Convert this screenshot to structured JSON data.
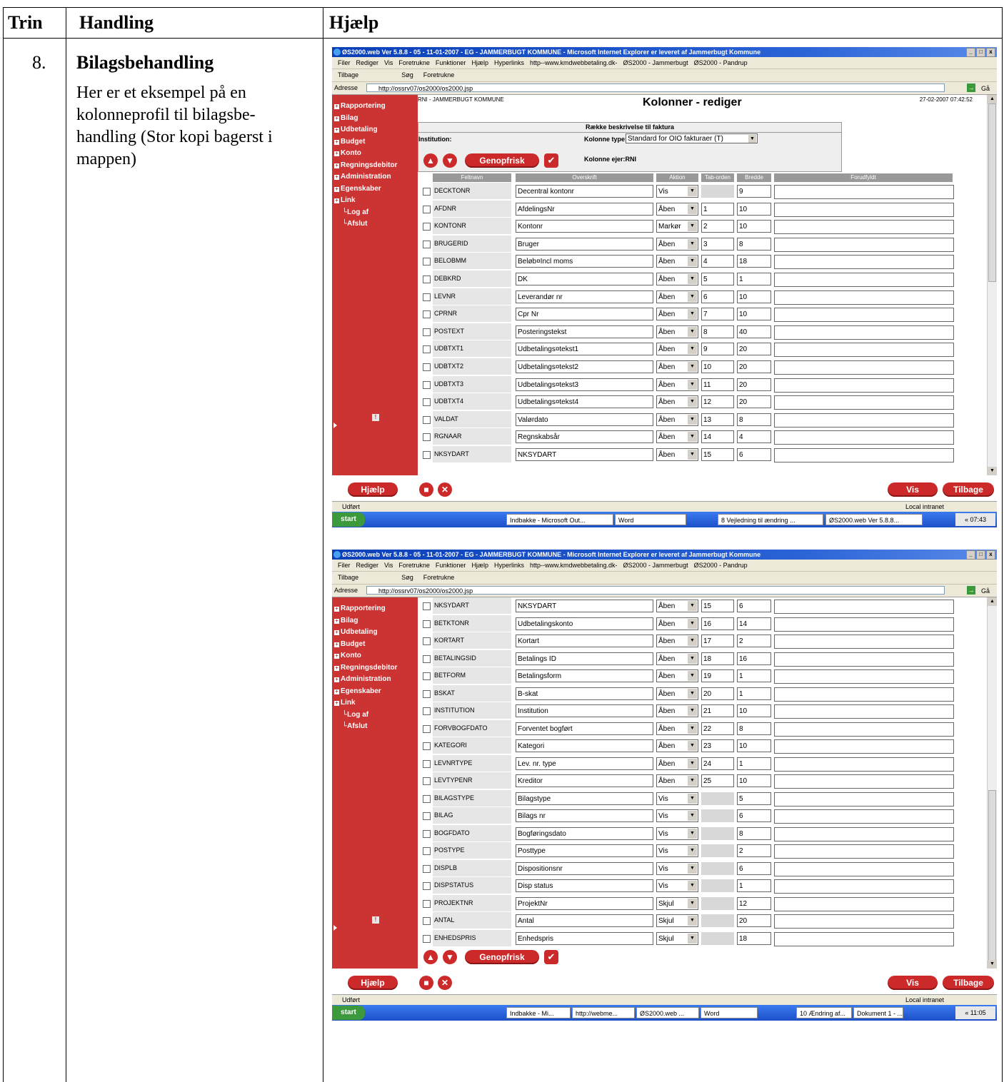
{
  "doc": {
    "headers": {
      "trin": "Trin",
      "handling": "Handling",
      "hjaelp": "Hjælp"
    },
    "step_number": "8.",
    "handling_title": "Bilagsbehandling",
    "handling_lines": [
      "Her er et eksempel på en",
      "kolonneprofil til bilagsbe-",
      "handling (Stor kopi bagerst i",
      "mappen)"
    ]
  },
  "browser": {
    "title": "ØS2000.web Ver 5.8.8 - 05 - 11-01-2007 - EG - JAMMERBUGT KOMMUNE - Microsoft Internet Explorer er leveret af Jammerbugt Kommune",
    "menu": [
      "Filer",
      "Rediger",
      "Vis",
      "Foretrukne",
      "Funktioner",
      "Hjælp",
      "Hyperlinks",
      "http--www.kmdwebbetaling.dk-",
      "ØS2000 - Jammerbugt",
      "ØS2000 - Pandrup"
    ],
    "toolbar": [
      "Tilbage",
      "Søg",
      "Foretrukne"
    ],
    "address_label": "Adresse",
    "address": "http://ossrv07/os2000/os2000.jsp",
    "go": "Gå",
    "status": "Udført",
    "zone": "Local intranet"
  },
  "sidebar": [
    "Rapportering",
    "Bilag",
    "Udbetaling",
    "Budget",
    "Konto",
    "Regningsdebitor",
    "Administration",
    "Egenskaber",
    "Link",
    "Log af",
    "Afslut"
  ],
  "page": {
    "header_left": "RNI  -  JAMMERBUGT KOMMUNE",
    "title": "Kolonner - rediger",
    "datetime": "27-02-2007 07:42:52",
    "desc_label": "Række beskrivelse til faktura",
    "institution_label": "Institution:",
    "kolonne_type_label": "Kolonne type:",
    "kolonne_type_value": "Standard for OIO fakturaer (T)",
    "kolonne_ejer": "Kolonne ejer:RNI",
    "refresh": "Genopfrisk",
    "columns": [
      "Feltnavn",
      "Overskrift",
      "Aktion",
      "Tab-orden",
      "Bredde",
      "Forudfyldt"
    ],
    "help": "Hjælp",
    "vis": "Vis",
    "tilbage": "Tilbage"
  },
  "rows1": [
    {
      "f": "DECKTONR",
      "o": "Decentral kontonr",
      "a": "Vis",
      "t": "",
      "b": "9"
    },
    {
      "f": "AFDNR",
      "o": "AfdelingsNr",
      "a": "Åben",
      "t": "1",
      "b": "10"
    },
    {
      "f": "KONTONR",
      "o": "Kontonr",
      "a": "Markør",
      "t": "2",
      "b": "10"
    },
    {
      "f": "BRUGERID",
      "o": "Bruger",
      "a": "Åben",
      "t": "3",
      "b": "8"
    },
    {
      "f": "BELOBMM",
      "o": "Beløb¤Incl moms",
      "a": "Åben",
      "t": "4",
      "b": "18"
    },
    {
      "f": "DEBKRD",
      "o": "DK",
      "a": "Åben",
      "t": "5",
      "b": "1"
    },
    {
      "f": "LEVNR",
      "o": "Leverandør nr",
      "a": "Åben",
      "t": "6",
      "b": "10"
    },
    {
      "f": "CPRNR",
      "o": "Cpr Nr",
      "a": "Åben",
      "t": "7",
      "b": "10"
    },
    {
      "f": "POSTEXT",
      "o": "Posteringstekst",
      "a": "Åben",
      "t": "8",
      "b": "40"
    },
    {
      "f": "UDBTXT1",
      "o": "Udbetalings¤tekst1",
      "a": "Åben",
      "t": "9",
      "b": "20"
    },
    {
      "f": "UDBTXT2",
      "o": "Udbetalings¤tekst2",
      "a": "Åben",
      "t": "10",
      "b": "20"
    },
    {
      "f": "UDBTXT3",
      "o": "Udbetalings¤tekst3",
      "a": "Åben",
      "t": "11",
      "b": "20"
    },
    {
      "f": "UDBTXT4",
      "o": "Udbetalings¤tekst4",
      "a": "Åben",
      "t": "12",
      "b": "20"
    },
    {
      "f": "VALDAT",
      "o": "Valørdato",
      "a": "Åben",
      "t": "13",
      "b": "8"
    },
    {
      "f": "RGNAAR",
      "o": "Regnskabsår",
      "a": "Åben",
      "t": "14",
      "b": "4"
    },
    {
      "f": "NKSYDART",
      "o": "NKSYDART",
      "a": "Åben",
      "t": "15",
      "b": "6"
    }
  ],
  "rows2": [
    {
      "f": "NKSYDART",
      "o": "NKSYDART",
      "a": "Åben",
      "t": "15",
      "b": "6"
    },
    {
      "f": "BETKTONR",
      "o": "Udbetalingskonto",
      "a": "Åben",
      "t": "16",
      "b": "14"
    },
    {
      "f": "KORTART",
      "o": "Kortart",
      "a": "Åben",
      "t": "17",
      "b": "2"
    },
    {
      "f": "BETALINGSID",
      "o": "Betalings ID",
      "a": "Åben",
      "t": "18",
      "b": "16"
    },
    {
      "f": "BETFORM",
      "o": "Betalingsform",
      "a": "Åben",
      "t": "19",
      "b": "1"
    },
    {
      "f": "BSKAT",
      "o": "B-skat",
      "a": "Åben",
      "t": "20",
      "b": "1"
    },
    {
      "f": "INSTITUTION",
      "o": "Institution",
      "a": "Åben",
      "t": "21",
      "b": "10"
    },
    {
      "f": "FORVBOGFDATO",
      "o": "Forventet bogført",
      "a": "Åben",
      "t": "22",
      "b": "8"
    },
    {
      "f": "KATEGORI",
      "o": "Kategori",
      "a": "Åben",
      "t": "23",
      "b": "10"
    },
    {
      "f": "LEVNRTYPE",
      "o": "Lev. nr. type",
      "a": "Åben",
      "t": "24",
      "b": "1"
    },
    {
      "f": "LEVTYPENR",
      "o": "Kreditor",
      "a": "Åben",
      "t": "25",
      "b": "10"
    },
    {
      "f": "BILAGSTYPE",
      "o": "Bilagstype",
      "a": "Vis",
      "t": "",
      "b": "5"
    },
    {
      "f": "BILAG",
      "o": "Bilags nr",
      "a": "Vis",
      "t": "",
      "b": "6"
    },
    {
      "f": "BOGFDATO",
      "o": "Bogføringsdato",
      "a": "Vis",
      "t": "",
      "b": "8"
    },
    {
      "f": "POSTYPE",
      "o": "Posttype",
      "a": "Vis",
      "t": "",
      "b": "2"
    },
    {
      "f": "DISPLB",
      "o": "Dispositionsnr",
      "a": "Vis",
      "t": "",
      "b": "6"
    },
    {
      "f": "DISPSTATUS",
      "o": "Disp status",
      "a": "Vis",
      "t": "",
      "b": "1"
    },
    {
      "f": "PROJEKTNR",
      "o": "ProjektNr",
      "a": "Skjul",
      "t": "",
      "b": "12"
    },
    {
      "f": "ANTAL",
      "o": "Antal",
      "a": "Skjul",
      "t": "",
      "b": "20"
    },
    {
      "f": "ENHEDSPRIS",
      "o": "Enhedspris",
      "a": "Skjul",
      "t": "",
      "b": "18"
    }
  ],
  "taskbar1": {
    "start": "start",
    "tasks": [
      "Indbakke - Microsoft Out...",
      "Word",
      "8 Vejledning til ændring ...",
      "ØS2000.web Ver 5.8.8..."
    ],
    "clock": "« 07:43"
  },
  "taskbar2": {
    "start": "start",
    "tasks": [
      "Indbakke - Mi...",
      "http://webme...",
      "ØS2000.web ...",
      "Word",
      "10 Ændring af...",
      "Dokument 1 - ..."
    ],
    "clock": "« 11:05"
  }
}
